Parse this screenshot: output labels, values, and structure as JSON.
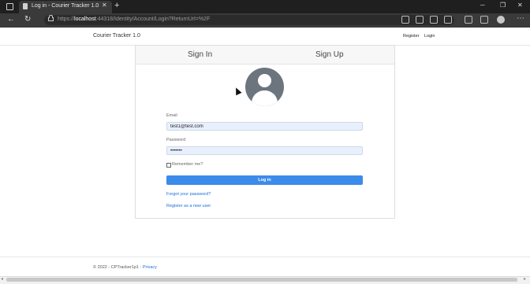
{
  "browser": {
    "tab_title": "Log in - Courier Tracker 1.0",
    "new_tab": "+",
    "url_prefix": "https://",
    "url_host": "localhost",
    "url_rest": ":44318/Identity/Account/Login?ReturnUrl=%2F"
  },
  "header": {
    "brand": "Courier Tracker 1.0",
    "register": "Register",
    "login": "Login"
  },
  "tabs": {
    "sign_in": "Sign In",
    "sign_up": "Sign Up"
  },
  "form": {
    "email_label": "Email",
    "email_value": "test1@test.com",
    "password_label": "Password",
    "password_value": "•••••••",
    "remember_label": "Remember me?",
    "login_button": "Log in",
    "forgot_link": "Forgot your password?",
    "register_link": "Register as a new user"
  },
  "footer": {
    "copyright": "© 2022 - CPTracker1p1 -",
    "privacy": "Privacy"
  },
  "colors": {
    "primary": "#3b8beb",
    "avatar": "#6c757d"
  }
}
